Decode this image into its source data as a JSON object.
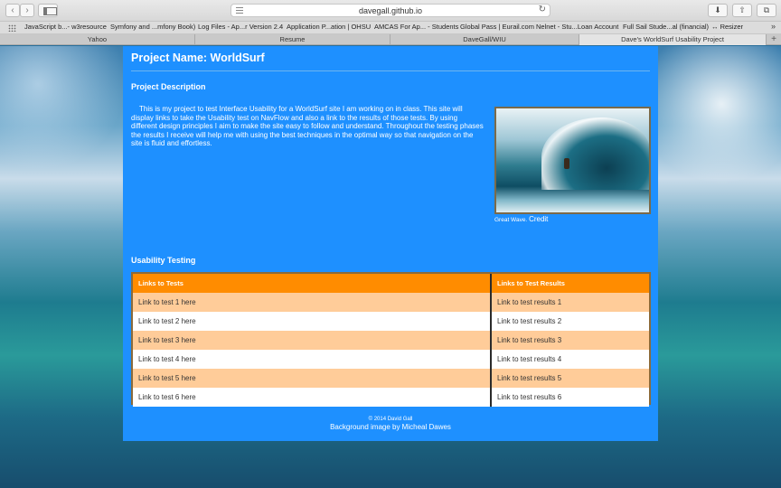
{
  "browser": {
    "url": "davegall.github.io",
    "back_label": "‹",
    "forward_label": "›",
    "reload_label": "↻",
    "download_label": "⬇",
    "share_label": "⇧",
    "tabs_label": "⧉",
    "bookmarks": [
      "JavaScript b...- w3resource",
      "Symfony and ...mfony Book)",
      "Log Files - Ap...r Version 2.4",
      "Application P...ation | OHSU",
      "AMCAS For Ap... - Students",
      "Global Pass | Eurail.com",
      "Nelnet - Stu...Loan Account",
      "Full Sail Stude...al (financial)",
      "↔ Resizer"
    ],
    "bookmarks_more": "»",
    "tabs": [
      "Yahoo",
      "Resume",
      "DaveGall/WIU",
      "Dave's WorldSurf Usability Project"
    ],
    "new_tab": "+"
  },
  "page": {
    "project_title": "Project Name: WorldSurf",
    "description_heading": "Project Description",
    "description": "This is my project to test Interface Usability for a WorldSurf site I am working on in class. This site will display links to take the Usability test on NavFlow and also a link to the results of those tests. By using different design principles I aim to make the site easy to follow and understand. Throughout the testing phases the results I receive will help me with using the best techniques in the optimal way so that navigation on the site is fluid and effortless.",
    "caption_text": "Great Wave. ",
    "caption_link": "Credit",
    "testing_heading": "Usability Testing",
    "table": {
      "headers": [
        "Links to Tests",
        "Links to Test Results"
      ],
      "rows": [
        [
          "Link to test 1 here",
          "Link to test results 1"
        ],
        [
          "Link to test 2 here",
          "Link to test results 2"
        ],
        [
          "Link to test 3 here",
          "Link to test results 3"
        ],
        [
          "Link to test 4 here",
          "Link to test results 4"
        ],
        [
          "Link to test 5 here",
          "Link to test results 5"
        ],
        [
          "Link to test 6 here",
          "Link to test results 6"
        ]
      ]
    },
    "footer_copyright": "© 2014 David Gall",
    "footer_credit": "Background image by Micheal Dawes"
  },
  "colors": {
    "page_bg": "#1e90ff",
    "table_header": "#ff8c00",
    "row_alt": "#ffcc99"
  }
}
